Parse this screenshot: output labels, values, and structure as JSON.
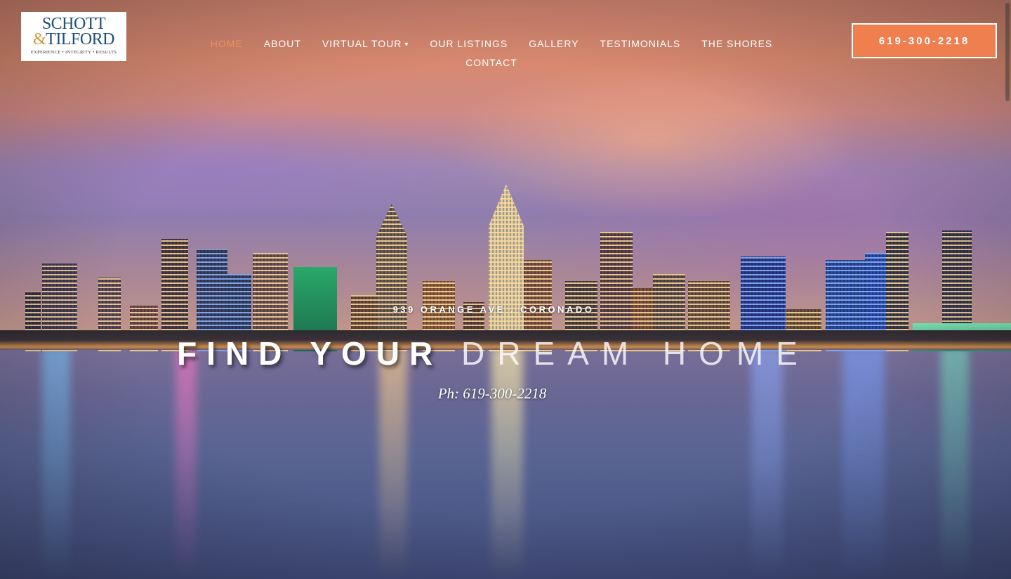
{
  "logo": {
    "line1": "SCHOTT",
    "amp": "&",
    "line2": "TILFORD",
    "tagline": "EXPERIENCE • INTEGRITY • RESULTS"
  },
  "nav": {
    "items": [
      {
        "label": "HOME",
        "active": true
      },
      {
        "label": "ABOUT"
      },
      {
        "label": "VIRTUAL TOUR",
        "has_dropdown": true,
        "icon": "chevron-down-icon"
      },
      {
        "label": "OUR LISTINGS"
      },
      {
        "label": "GALLERY"
      },
      {
        "label": "TESTIMONIALS"
      },
      {
        "label": "THE SHORES"
      },
      {
        "label": "CONTACT"
      }
    ]
  },
  "header": {
    "phone_button": "619-300-2218"
  },
  "hero": {
    "address": "939 ORANGE AVE . CORONADO",
    "headline_strong": "FIND YOUR",
    "headline_light": "DREAM HOME",
    "phone": "Ph: 619-300-2218"
  },
  "colors": {
    "accent": "#ef7f4f",
    "nav_active": "#ee8f5f",
    "logo_blue": "#1f4f7a",
    "logo_gold": "#c79a3a"
  }
}
